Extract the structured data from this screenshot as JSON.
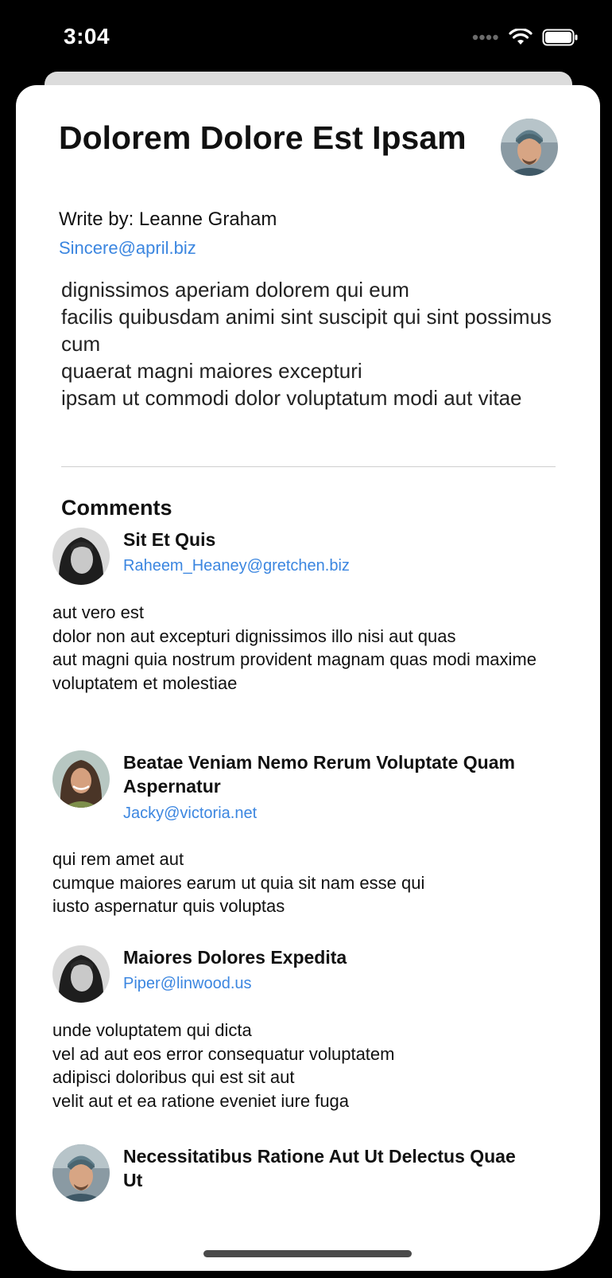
{
  "status_bar": {
    "time": "3:04"
  },
  "post": {
    "title": "Dolorem Dolore Est Ipsam",
    "author_line": "Write by: Leanne Graham",
    "author_email": "Sincere@april.biz",
    "body": "dignissimos aperiam dolorem qui eum\nfacilis quibusdam animi sint suscipit qui sint possimus cum\nquaerat magni maiores excepturi\nipsam ut commodi dolor voluptatum modi aut vitae"
  },
  "comments_heading": "Comments",
  "comments": [
    {
      "name": "Sit Et Quis",
      "email": "Raheem_Heaney@gretchen.biz",
      "body": "aut vero est\ndolor non aut excepturi dignissimos illo nisi aut quas\naut magni quia nostrum provident magnam quas modi maxime\nvoluptatem et molestiae"
    },
    {
      "name": "Beatae Veniam Nemo Rerum Voluptate Quam Aspernatur",
      "email": "Jacky@victoria.net",
      "body": "qui rem amet aut\ncumque maiores earum ut quia sit nam esse qui\niusto aspernatur quis voluptas"
    },
    {
      "name": "Maiores Dolores Expedita",
      "email": "Piper@linwood.us",
      "body": "unde voluptatem qui dicta\nvel ad aut eos error consequatur voluptatem\nadipisci doloribus qui est sit aut\nvelit aut et ea ratione eveniet iure fuga"
    },
    {
      "name": "Necessitatibus Ratione Aut Ut Delectus Quae Ut",
      "email": "",
      "body": ""
    }
  ],
  "colors": {
    "link": "#3b86e0",
    "background": "#ffffff",
    "frame": "#000000"
  }
}
